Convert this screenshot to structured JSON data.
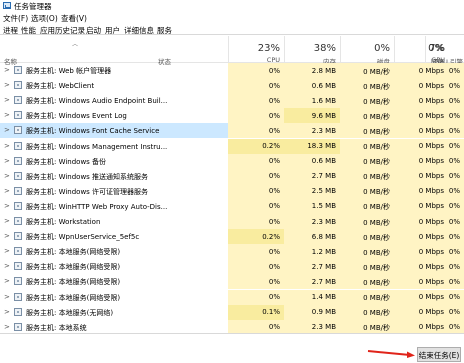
{
  "window": {
    "title": "任务管理器"
  },
  "menu": [
    "文件(F)",
    "选项(O)",
    "查看(V)"
  ],
  "tabs": [
    "进程",
    "性能",
    "应用历史记录",
    "启动",
    "用户",
    "详细信息",
    "服务"
  ],
  "header": {
    "name": "名称",
    "status": "状态",
    "cpu": {
      "pct": "23%",
      "label": "CPU"
    },
    "mem": {
      "pct": "38%",
      "label": "内存"
    },
    "disk": {
      "pct": "0%",
      "label": "磁盘"
    },
    "net": {
      "pct": "0%",
      "label": "网络"
    },
    "gpu": {
      "pct": "7%",
      "label": "GPU"
    },
    "gpu_engine": "GPU 引擎"
  },
  "rows": [
    {
      "name": "服务主机: Web 帐户管理器",
      "cpu": "0%",
      "mem": "2.8 MB",
      "disk": "0 MB/秒",
      "net": "0 Mbps",
      "gpu": "0%"
    },
    {
      "name": "服务主机: WebClient",
      "cpu": "0%",
      "mem": "0.6 MB",
      "disk": "0 MB/秒",
      "net": "0 Mbps",
      "gpu": "0%"
    },
    {
      "name": "服务主机: Windows Audio Endpoint Buil...",
      "cpu": "0%",
      "mem": "1.6 MB",
      "disk": "0 MB/秒",
      "net": "0 Mbps",
      "gpu": "0%"
    },
    {
      "name": "服务主机: Windows Event Log",
      "cpu": "0%",
      "mem": "9.6 MB",
      "disk": "0 MB/秒",
      "net": "0 Mbps",
      "gpu": "0%"
    },
    {
      "name": "服务主机: Windows Font Cache Service",
      "cpu": "0%",
      "mem": "2.3 MB",
      "disk": "0 MB/秒",
      "net": "0 Mbps",
      "gpu": "0%",
      "selected": true
    },
    {
      "name": "服务主机: Windows Management Instru...",
      "cpu": "0.2%",
      "mem": "18.3 MB",
      "disk": "0 MB/秒",
      "net": "0 Mbps",
      "gpu": "0%"
    },
    {
      "name": "服务主机: Windows 备份",
      "cpu": "0%",
      "mem": "0.6 MB",
      "disk": "0 MB/秒",
      "net": "0 Mbps",
      "gpu": "0%"
    },
    {
      "name": "服务主机: Windows 推送通知系统服务",
      "cpu": "0%",
      "mem": "2.7 MB",
      "disk": "0 MB/秒",
      "net": "0 Mbps",
      "gpu": "0%"
    },
    {
      "name": "服务主机: Windows 许可证管理器服务",
      "cpu": "0%",
      "mem": "2.5 MB",
      "disk": "0 MB/秒",
      "net": "0 Mbps",
      "gpu": "0%"
    },
    {
      "name": "服务主机: WinHTTP Web Proxy Auto-Dis...",
      "cpu": "0%",
      "mem": "1.5 MB",
      "disk": "0 MB/秒",
      "net": "0 Mbps",
      "gpu": "0%"
    },
    {
      "name": "服务主机: Workstation",
      "cpu": "0%",
      "mem": "2.3 MB",
      "disk": "0 MB/秒",
      "net": "0 Mbps",
      "gpu": "0%"
    },
    {
      "name": "服务主机: WpnUserService_5ef5c",
      "cpu": "0.2%",
      "mem": "6.8 MB",
      "disk": "0 MB/秒",
      "net": "0 Mbps",
      "gpu": "0%"
    },
    {
      "name": "服务主机: 本地服务(网络受限)",
      "cpu": "0%",
      "mem": "1.2 MB",
      "disk": "0 MB/秒",
      "net": "0 Mbps",
      "gpu": "0%"
    },
    {
      "name": "服务主机: 本地服务(网络受限)",
      "cpu": "0%",
      "mem": "2.7 MB",
      "disk": "0 MB/秒",
      "net": "0 Mbps",
      "gpu": "0%"
    },
    {
      "name": "服务主机: 本地服务(网络受限)",
      "cpu": "0%",
      "mem": "2.7 MB",
      "disk": "0 MB/秒",
      "net": "0 Mbps",
      "gpu": "0%"
    },
    {
      "name": "服务主机: 本地服务(网络受限)",
      "cpu": "0%",
      "mem": "1.4 MB",
      "disk": "0 MB/秒",
      "net": "0 Mbps",
      "gpu": "0%"
    },
    {
      "name": "服务主机: 本地服务(无网络)",
      "cpu": "0.1%",
      "mem": "0.9 MB",
      "disk": "0 MB/秒",
      "net": "0 Mbps",
      "gpu": "0%"
    },
    {
      "name": "服务主机: 本地系统",
      "cpu": "0%",
      "mem": "2.3 MB",
      "disk": "0 MB/秒",
      "net": "0 Mbps",
      "gpu": "0%"
    }
  ],
  "footer": {
    "end_task": "结束任务(E)"
  },
  "colors": {
    "cpu_bg": "#fff4c4",
    "cpu_bg_high": "#f9ec9f",
    "mem_bg": "#fff4c4",
    "mem_bg_high": "#f9ec9f",
    "other_bg": "#fff4c4",
    "selected": "#cce8ff",
    "arrow": "#e0241a"
  }
}
